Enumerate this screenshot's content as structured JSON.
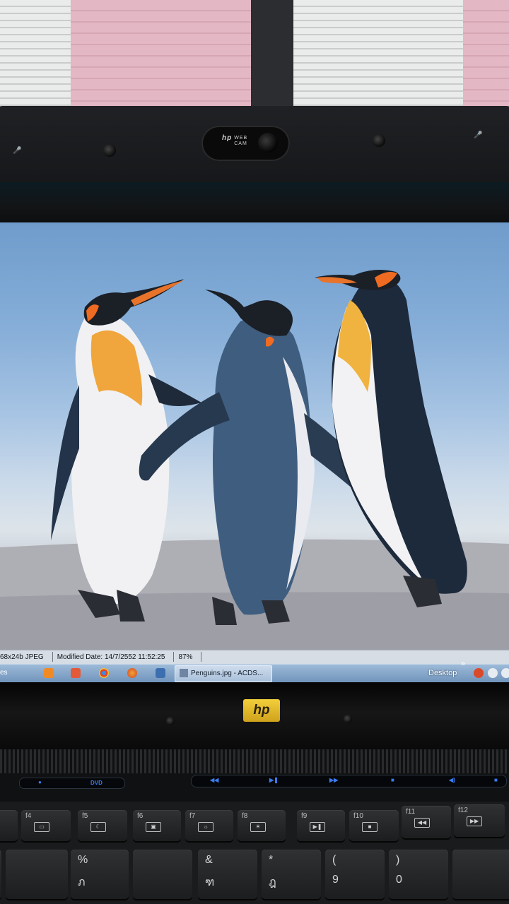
{
  "photo": {
    "webcam_label_line1": "WEB",
    "webcam_label_line2": "CAM",
    "webcam_brand": "hp",
    "laptop_logo": "hp"
  },
  "screen": {
    "image_subject": "penguins",
    "status_bar": {
      "image_info": "68x24b JPEG",
      "modified": "Modified Date: 14/7/2552 11:52:25",
      "zoom": "87%"
    },
    "taskbar": {
      "left_fragment": "es",
      "active_window": "Penguins.jpg - ACDS...",
      "desktop_label": "Desktop",
      "chevron": "»"
    }
  },
  "keyboard": {
    "media_left": [
      "DVD"
    ],
    "function_keys": [
      "f4",
      "f5",
      "f6",
      "f7",
      "f8",
      "f9",
      "f10",
      "f11",
      "f12"
    ],
    "number_keys": [
      {
        "top": "%",
        "bottom": "ภ"
      },
      {
        "top": "&",
        "bottom": "ฑ"
      },
      {
        "top": "*",
        "bottom": "ฎ"
      },
      {
        "top": "(",
        "bottom": "9"
      },
      {
        "top": ")",
        "bottom": "0"
      }
    ]
  },
  "colors": {
    "taskbar": "#7a9bc2",
    "hp_logo": "#e6bd2c",
    "media_led": "#3a7cf1"
  }
}
